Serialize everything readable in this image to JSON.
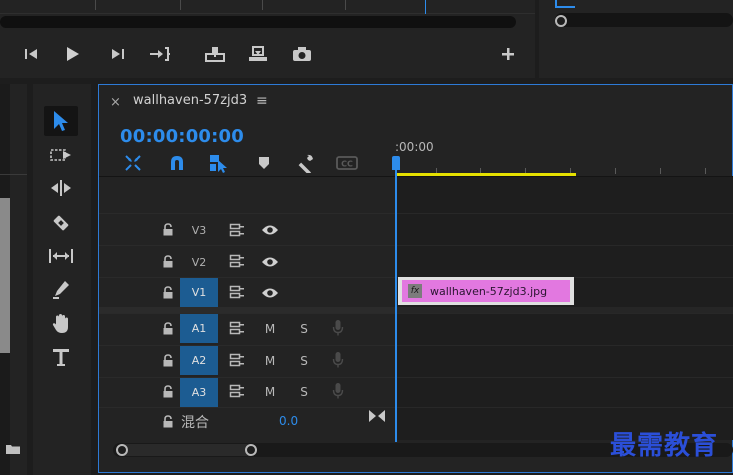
{
  "sequence": {
    "tab_close": "×",
    "name": "wallhaven-57zjd3",
    "menu": "≡",
    "timecode": "00:00:00:00",
    "ruler_label": ":00:00"
  },
  "tracks": {
    "video": [
      {
        "label": "V3",
        "targeted": false
      },
      {
        "label": "V2",
        "targeted": false
      },
      {
        "label": "V1",
        "targeted": true
      }
    ],
    "audio": [
      {
        "label": "A1",
        "mute": "M",
        "solo": "S"
      },
      {
        "label": "A2",
        "mute": "M",
        "solo": "S"
      },
      {
        "label": "A3",
        "mute": "M",
        "solo": "S"
      }
    ],
    "mix": {
      "label": "混合",
      "value": "0.0"
    }
  },
  "clip": {
    "fx_badge": "fx",
    "name": "wallhaven-57zjd3.jpg",
    "color": "#e278e0"
  },
  "colors": {
    "accent": "#2d8ceb",
    "work_area": "#e5e000",
    "track_target": "#1c5c92"
  },
  "icons": {
    "tools": [
      "selection-icon",
      "track-select-icon",
      "ripple-edit-icon",
      "razor-icon",
      "slip-icon",
      "pen-icon",
      "hand-icon",
      "type-icon"
    ],
    "monitor": [
      "mark-in-icon",
      "play-icon",
      "step-forward-icon",
      "go-to-out-icon",
      "insert-icon",
      "overwrite-icon",
      "camera-icon",
      "add-icon"
    ],
    "timeline": [
      "nest-icon",
      "snap-icon",
      "linked-selection-icon",
      "marker-icon",
      "wrench-icon",
      "captions-icon"
    ]
  },
  "watermark": "最需教育"
}
